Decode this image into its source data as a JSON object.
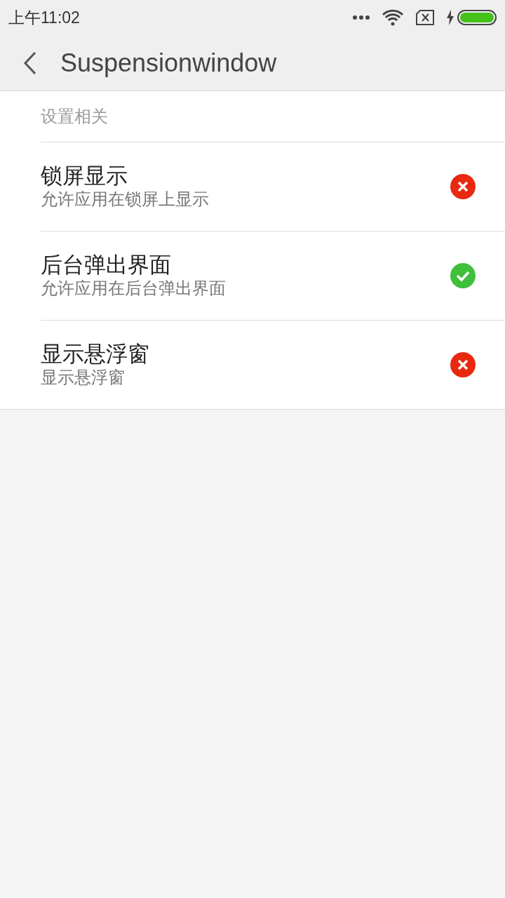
{
  "status_bar": {
    "time": "上午11:02"
  },
  "app_bar": {
    "title": "Suspensionwindow"
  },
  "section": {
    "title": "设置相关"
  },
  "items": [
    {
      "title": "锁屏显示",
      "subtitle": "允许应用在锁屏上显示",
      "enabled": false
    },
    {
      "title": "后台弹出界面",
      "subtitle": "允许应用在后台弹出界面",
      "enabled": true
    },
    {
      "title": "显示悬浮窗",
      "subtitle": "显示悬浮窗",
      "enabled": false
    }
  ]
}
